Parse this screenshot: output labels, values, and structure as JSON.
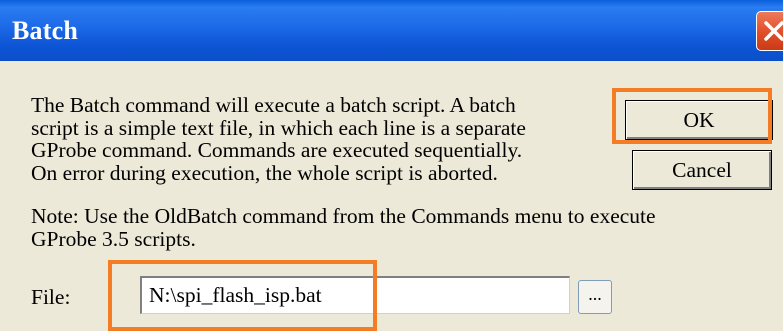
{
  "window": {
    "title": "Batch"
  },
  "message": {
    "text": "The Batch command will execute a batch script. A batch\nscript is a simple text file, in which each line is a separate\nGProbe command. Commands are executed sequentially.\nOn error during execution, the whole script is aborted.",
    "note": "Note:  Use the OldBatch command from the Commands menu to execute\nGProbe 3.5 scripts."
  },
  "buttons": {
    "ok_label": "OK",
    "cancel_label": "Cancel",
    "browse_label": "..."
  },
  "file": {
    "label": "File:",
    "value": "N:\\spi_flash_isp.bat"
  },
  "icons": {
    "close": "close-icon"
  },
  "colors": {
    "titlebar": "#0b55d8",
    "close_button": "#e3512b",
    "highlight": "#f47c25",
    "dialog_background": "#ece9d8"
  }
}
